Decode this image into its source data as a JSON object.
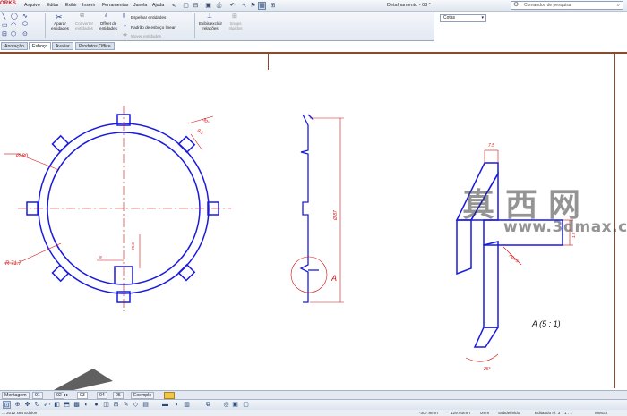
{
  "app": {
    "logo": "ORKS"
  },
  "menu": [
    "Arquivo",
    "Editar",
    "Exibir",
    "Inserir",
    "Ferramentas",
    "Janela",
    "Ajuda"
  ],
  "document_title": "Detalhamento - 03 *",
  "search": {
    "placeholder": "Comandos de pesquisa"
  },
  "ribbon": {
    "aparar": "Aparar\nentidades",
    "converter": "Converter\nentidades",
    "offset": "Offset de\nentidades",
    "espelhar": "Espelhar entidades",
    "padrao": "Padrão de esboço linear",
    "mover": "Mover entidades",
    "exibir_relacoes": "Exibir/excluir\nrelações",
    "snaps": "Snaps\nrápidos",
    "cotas": "Cotas"
  },
  "ribbon_tabs": [
    "Anotação",
    "Esboço",
    "Avaliar",
    "Produtos Office"
  ],
  "ribbon_active_tab": "Esboço",
  "drawing": {
    "dim_diameter_outer": "Ø 80",
    "dim_radius": "R 71.7",
    "dim_angle_top": "30°",
    "dim_gap_top": "9.5",
    "dim_tab_width": "9",
    "dim_inner_height": "25.6",
    "dim_side_height": "Ø 87",
    "detail_label": "A",
    "detail_title": "A  (5 : 1)",
    "dim_detail_width": "7.5",
    "dim_detail_offset": "1.5",
    "dim_detail_radius": "R0.75",
    "dim_detail_angle": "25°"
  },
  "watermark": {
    "cn": "真西网",
    "url": "www.3dmax.com"
  },
  "sheet_tabs": [
    "Montagem",
    "01",
    "02",
    "03",
    "04",
    "05",
    "Exemplo"
  ],
  "sheet_active": "03",
  "status": {
    "left": "... 2012 x64 Edition",
    "coord_x": "-307.8mm",
    "coord_y": "129.93mm",
    "coord_z": "0mm",
    "state": "Subdefinido",
    "edit": "Editando Fl. 3",
    "scale": "1 : 1",
    "units": "MMGS"
  },
  "colors": {
    "geometry": "#1a1ae0",
    "dimension": "#d01010",
    "sheet_border": "#8b4a2b",
    "ribbon_bg": "#e3e9f2"
  }
}
